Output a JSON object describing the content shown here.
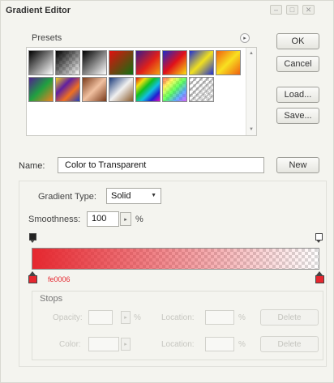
{
  "window": {
    "title": "Gradient Editor",
    "controls": [
      "minimize-icon",
      "maximize-icon",
      "close-icon"
    ],
    "minimize_glyph": "–",
    "maximize_glyph": "□",
    "close_glyph": "✕"
  },
  "presets": {
    "label": "Presets",
    "menu_glyph": "▸",
    "scroll_up_glyph": "▲",
    "scroll_down_glyph": "▼",
    "swatches": [
      {
        "name": "foreground-to-background",
        "css": "linear-gradient(135deg,#000 0%,#fff 100%)"
      },
      {
        "name": "foreground-to-transparent",
        "css": "linear-gradient(135deg,#000 0%,rgba(0,0,0,0) 100%)"
      },
      {
        "name": "black-white",
        "css": "linear-gradient(135deg,#000 0%,#fff 100%)"
      },
      {
        "name": "red-green",
        "css": "linear-gradient(135deg,#e01010 0%,#107010 100%)"
      },
      {
        "name": "violet-orange",
        "css": "linear-gradient(135deg,#3a1a8a 0%,#e0201a 55%,#f0a010 100%)"
      },
      {
        "name": "blue-red-yellow",
        "css": "linear-gradient(135deg,#1a2ac8 0%,#e0101a 50%,#f8e010 100%)"
      },
      {
        "name": "blue-yellow-blue",
        "css": "linear-gradient(135deg,#2030d0 0%,#f0e020 50%,#2030d0 100%)"
      },
      {
        "name": "orange-yellow-orange",
        "css": "linear-gradient(135deg,#f06010 0%,#f8e020 50%,#f06010 100%)"
      },
      {
        "name": "violet-green-orange",
        "css": "linear-gradient(135deg,#502090 0%,#20a040 50%,#f08020 100%)"
      },
      {
        "name": "yellow-violet-orange-blue",
        "css": "linear-gradient(135deg,#f0d020 0%,#6020a0 35%,#f07020 65%,#2040c0 100%)"
      },
      {
        "name": "copper",
        "css": "linear-gradient(135deg,#7a3a1a 0%,#f0c0a0 50%,#7a3a1a 100%)"
      },
      {
        "name": "chrome",
        "css": "linear-gradient(135deg,#1a3a7a 0%,#f0f0f0 50%,#8a5a2a 100%)"
      },
      {
        "name": "spectrum",
        "css": "linear-gradient(135deg,#e01010 0%,#f0e010 20%,#10c020 40%,#10c0e0 60%,#2020d0 80%,#e010c0 100%)"
      },
      {
        "name": "transparent-rainbow",
        "css": "linear-gradient(135deg,rgba(255,0,0,0.6) 0%,rgba(255,255,0,0.6) 25%,rgba(0,255,0,0.6) 50%,rgba(0,120,255,0.6) 75%,rgba(200,0,255,0.6) 100%)"
      },
      {
        "name": "transparent-stripes",
        "css": "repeating-linear-gradient(135deg,rgba(0,0,0,0.25) 0 2px,rgba(0,0,0,0) 2px 5px)"
      }
    ]
  },
  "buttons": {
    "ok": "OK",
    "cancel": "Cancel",
    "load": "Load...",
    "save": "Save...",
    "new": "New"
  },
  "name": {
    "label": "Name:",
    "value": "Color to Transparent"
  },
  "gradient_type": {
    "label": "Gradient Type:",
    "value": "Solid",
    "caret_glyph": "▼"
  },
  "smoothness": {
    "label": "Smoothness:",
    "value": "100",
    "unit": "%",
    "stepper_glyph": "▸"
  },
  "gradient": {
    "start_color": "#e5272f",
    "color_code": "fe0006"
  },
  "stops": {
    "label": "Stops",
    "opacity_label": "Opacity:",
    "location_label": "Location:",
    "color_label": "Color:",
    "unit": "%",
    "delete_label": "Delete",
    "stepper_glyph": "▸"
  }
}
